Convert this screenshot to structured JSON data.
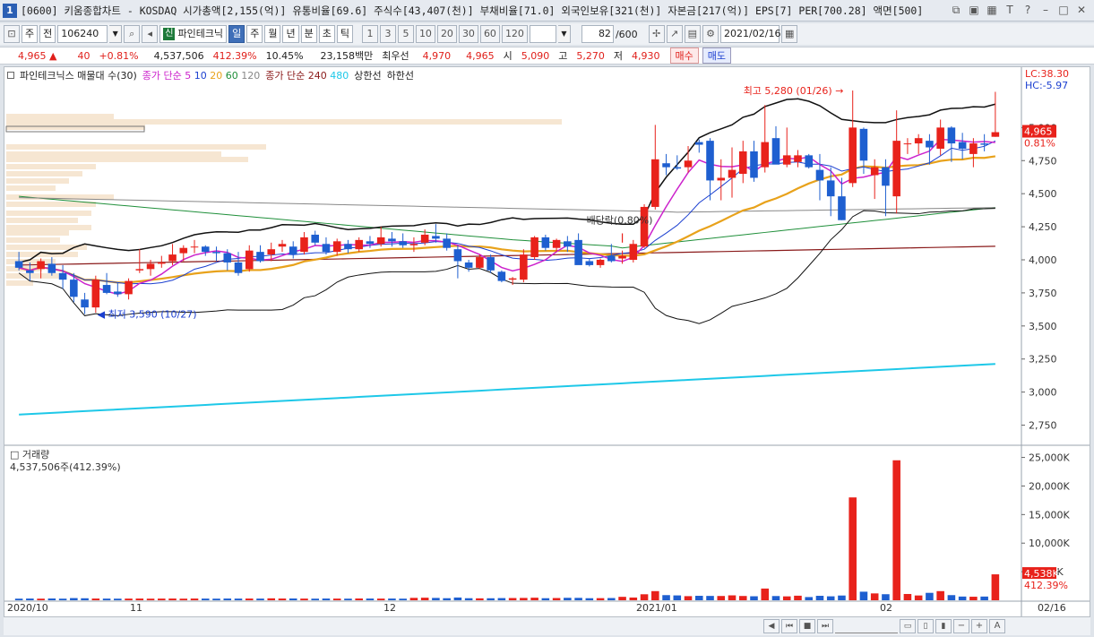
{
  "titlebar": {
    "window_number": "1",
    "text": "[0600] 키움종합차트 - KOSDAQ 시가총액[2,155(억)] 유통비율[69.6] 주식수[43,407(천)] 부채비율[71.0] 외국인보유[321(천)] 자본금[217(억)] EPS[7] PER[700.28] 액면[500]"
  },
  "toolbar": {
    "period_a": "주",
    "period_b": "전",
    "stock_code": "106240",
    "stock_badge": "신",
    "stock_name": "파인테크닉",
    "timeframes": [
      "일",
      "주",
      "월",
      "년",
      "분",
      "초",
      "틱"
    ],
    "numbers": [
      "1",
      "3",
      "5",
      "10",
      "20",
      "30",
      "60",
      "120"
    ],
    "count": "82",
    "count_total": "/600",
    "date": "2021/02/16"
  },
  "quote": {
    "price": "4,965",
    "change": "40",
    "change_pct": "+0.81%",
    "volume": "4,537,506",
    "volume_ratio": "412.39%",
    "turnover": "10.45%",
    "amount": "23,158백만",
    "best_label": "최우선",
    "best_ask": "4,970",
    "best_bid": "4,965",
    "open_label": "시",
    "open": "5,090",
    "high_label": "고",
    "high": "5,270",
    "low_label": "저",
    "low": "4,930",
    "buy_btn": "매수",
    "sell_btn": "매도"
  },
  "legend": {
    "name": "파인테크닉스 매물대 수(30)",
    "ma_label_a": "종가 단순",
    "ma_a": [
      "5",
      "10",
      "20",
      "60",
      "120"
    ],
    "ma_label_b": "종가 단순",
    "ma_b": [
      "240",
      "480"
    ],
    "upper": "상한선",
    "lower": "하한선"
  },
  "annotations": {
    "high": "최고 5,280 (01/26)",
    "low": "최저 3,590 (10/27)",
    "dividend": "배당락(0.80%)",
    "lc": "LC:38.30",
    "hc": "HC:-5.97",
    "last_price": "4,965",
    "last_pct": "0.81%"
  },
  "volume_panel": {
    "title": "거래량",
    "value": "4,537,506주(412.39%)",
    "last": "4,538K",
    "last_pct": "412.39%"
  },
  "x_labels": [
    "2020/10",
    "11",
    "12",
    "2021/01",
    "02",
    "02/16"
  ],
  "colors": {
    "up": "#e8221b",
    "down": "#1e5fd0",
    "ma5": "#cc22cc",
    "ma10": "#1b3fd0",
    "ma20": "#e8a21b",
    "ma60": "#1f8f3a",
    "ma120": "#888888",
    "ma240": "#8a1a1a",
    "ma480": "#1ec8e8"
  },
  "chart_data": {
    "type": "candlestick",
    "ylim": [
      2625,
      5375
    ],
    "y_ticks": [
      "5,000",
      "4,750",
      "4,500",
      "4,250",
      "4,000",
      "3,750",
      "3,500",
      "3,250",
      "3,000",
      "2,750"
    ],
    "candles": [
      [
        3990,
        4060,
        3920,
        3940
      ],
      [
        3920,
        3980,
        3840,
        3900
      ],
      [
        3930,
        4010,
        3860,
        3990
      ],
      [
        3970,
        4020,
        3880,
        3900
      ],
      [
        3900,
        3960,
        3780,
        3850
      ],
      [
        3850,
        3900,
        3680,
        3720
      ],
      [
        3700,
        3750,
        3590,
        3640
      ],
      [
        3640,
        3880,
        3600,
        3850
      ],
      [
        3810,
        3900,
        3740,
        3750
      ],
      [
        3760,
        3830,
        3720,
        3740
      ],
      [
        3740,
        3860,
        3700,
        3840
      ],
      [
        3920,
        4080,
        3900,
        3930
      ],
      [
        3930,
        4000,
        3880,
        3970
      ],
      [
        3970,
        4030,
        3940,
        3980
      ],
      [
        3990,
        4120,
        3960,
        4040
      ],
      [
        4050,
        4110,
        3990,
        4090
      ],
      [
        4100,
        4150,
        4050,
        4100
      ],
      [
        4100,
        4110,
        4030,
        4060
      ],
      [
        4060,
        4100,
        3990,
        4050
      ],
      [
        4050,
        4080,
        3920,
        3980
      ],
      [
        3980,
        4060,
        3880,
        3900
      ],
      [
        3930,
        4110,
        3910,
        4070
      ],
      [
        4060,
        4110,
        3980,
        3990
      ],
      [
        4040,
        4130,
        3990,
        4080
      ],
      [
        4100,
        4150,
        4060,
        4120
      ],
      [
        4100,
        4140,
        4010,
        4040
      ],
      [
        4060,
        4210,
        4040,
        4170
      ],
      [
        4190,
        4220,
        4110,
        4130
      ],
      [
        4120,
        4170,
        4040,
        4060
      ],
      [
        4060,
        4160,
        4030,
        4140
      ],
      [
        4120,
        4150,
        4050,
        4080
      ],
      [
        4080,
        4170,
        4060,
        4150
      ],
      [
        4140,
        4180,
        4090,
        4120
      ],
      [
        4120,
        4250,
        4100,
        4170
      ],
      [
        4160,
        4210,
        4100,
        4140
      ],
      [
        4140,
        4200,
        4090,
        4110
      ],
      [
        4110,
        4170,
        4060,
        4120
      ],
      [
        4130,
        4230,
        4110,
        4190
      ],
      [
        4180,
        4270,
        4130,
        4160
      ],
      [
        4160,
        4200,
        4070,
        4090
      ],
      [
        4080,
        4110,
        3860,
        3990
      ],
      [
        3980,
        4000,
        3910,
        3940
      ],
      [
        3940,
        4040,
        3930,
        4020
      ],
      [
        4020,
        4040,
        3900,
        3920
      ],
      [
        3910,
        3920,
        3830,
        3840
      ],
      [
        3850,
        3870,
        3810,
        3860
      ],
      [
        3850,
        4080,
        3830,
        4040
      ],
      [
        4020,
        4180,
        4000,
        4170
      ],
      [
        4170,
        4190,
        4070,
        4090
      ],
      [
        4090,
        4160,
        4060,
        4150
      ],
      [
        4140,
        4180,
        4060,
        4100
      ],
      [
        4150,
        4200,
        3970,
        3960
      ],
      [
        3990,
        4010,
        3950,
        3960
      ],
      [
        3960,
        4010,
        3940,
        4000
      ],
      [
        4030,
        4120,
        3980,
        3990
      ],
      [
        4010,
        4070,
        3970,
        4030
      ],
      [
        4000,
        4150,
        3980,
        4120
      ],
      [
        4100,
        4420,
        4090,
        4400
      ],
      [
        4400,
        5020,
        4380,
        4760
      ],
      [
        4730,
        4800,
        4640,
        4700
      ],
      [
        4700,
        4790,
        4680,
        4690
      ],
      [
        4700,
        4860,
        4660,
        4750
      ],
      [
        4890,
        4910,
        4810,
        4870
      ],
      [
        4900,
        4920,
        4450,
        4600
      ],
      [
        4600,
        4760,
        4450,
        4620
      ],
      [
        4620,
        4850,
        4470,
        4680
      ],
      [
        4650,
        4900,
        4580,
        4820
      ],
      [
        4820,
        4900,
        4590,
        4620
      ],
      [
        4700,
        5170,
        4660,
        4890
      ],
      [
        4920,
        5010,
        4750,
        4720
      ],
      [
        4720,
        5000,
        4700,
        4790
      ],
      [
        4740,
        4830,
        4700,
        4790
      ],
      [
        4790,
        4800,
        4690,
        4700
      ],
      [
        4680,
        4800,
        4450,
        4600
      ],
      [
        4600,
        4700,
        4330,
        4480
      ],
      [
        4480,
        4620,
        4300,
        4300
      ],
      [
        4580,
        5280,
        4550,
        5000
      ],
      [
        4990,
        5000,
        4650,
        4750
      ],
      [
        4640,
        4760,
        4460,
        4700
      ],
      [
        4700,
        4760,
        4330,
        4560
      ],
      [
        4480,
        5130,
        4350,
        4900
      ],
      [
        4880,
        4920,
        4800,
        4880
      ],
      [
        4880,
        4950,
        4800,
        4920
      ],
      [
        4900,
        4950,
        4720,
        4850
      ],
      [
        4840,
        5060,
        4790,
        5000
      ],
      [
        5000,
        5010,
        4740,
        4880
      ],
      [
        4890,
        4960,
        4760,
        4840
      ],
      [
        4800,
        4920,
        4700,
        4880
      ],
      [
        4880,
        4950,
        4820,
        4870
      ],
      [
        4930,
        5270,
        4930,
        4965
      ]
    ],
    "volumes": [
      280,
      300,
      280,
      310,
      280,
      380,
      350,
      300,
      290,
      280,
      290,
      300,
      280,
      290,
      300,
      280,
      300,
      290,
      280,
      300,
      290,
      300,
      290,
      340,
      300,
      310,
      290,
      280,
      300,
      290,
      280,
      310,
      300,
      290,
      300,
      280,
      420,
      450,
      410,
      360,
      480,
      360,
      340,
      350,
      380,
      390,
      410,
      450,
      360,
      390,
      430,
      420,
      360,
      370,
      390,
      600,
      480,
      1050,
      1600,
      900,
      850,
      720,
      780,
      760,
      750,
      860,
      750,
      700,
      2050,
      740,
      680,
      800,
      560,
      780,
      690,
      830,
      18000,
      1500,
      1200,
      1060,
      24500,
      1100,
      840,
      1300,
      1600,
      900,
      650,
      620,
      650,
      4538
    ],
    "vol_ylim": [
      0,
      26500
    ],
    "vol_ticks": [
      "25,000K",
      "20,000K",
      "15,000K",
      "10,000K",
      "5,000K"
    ]
  }
}
